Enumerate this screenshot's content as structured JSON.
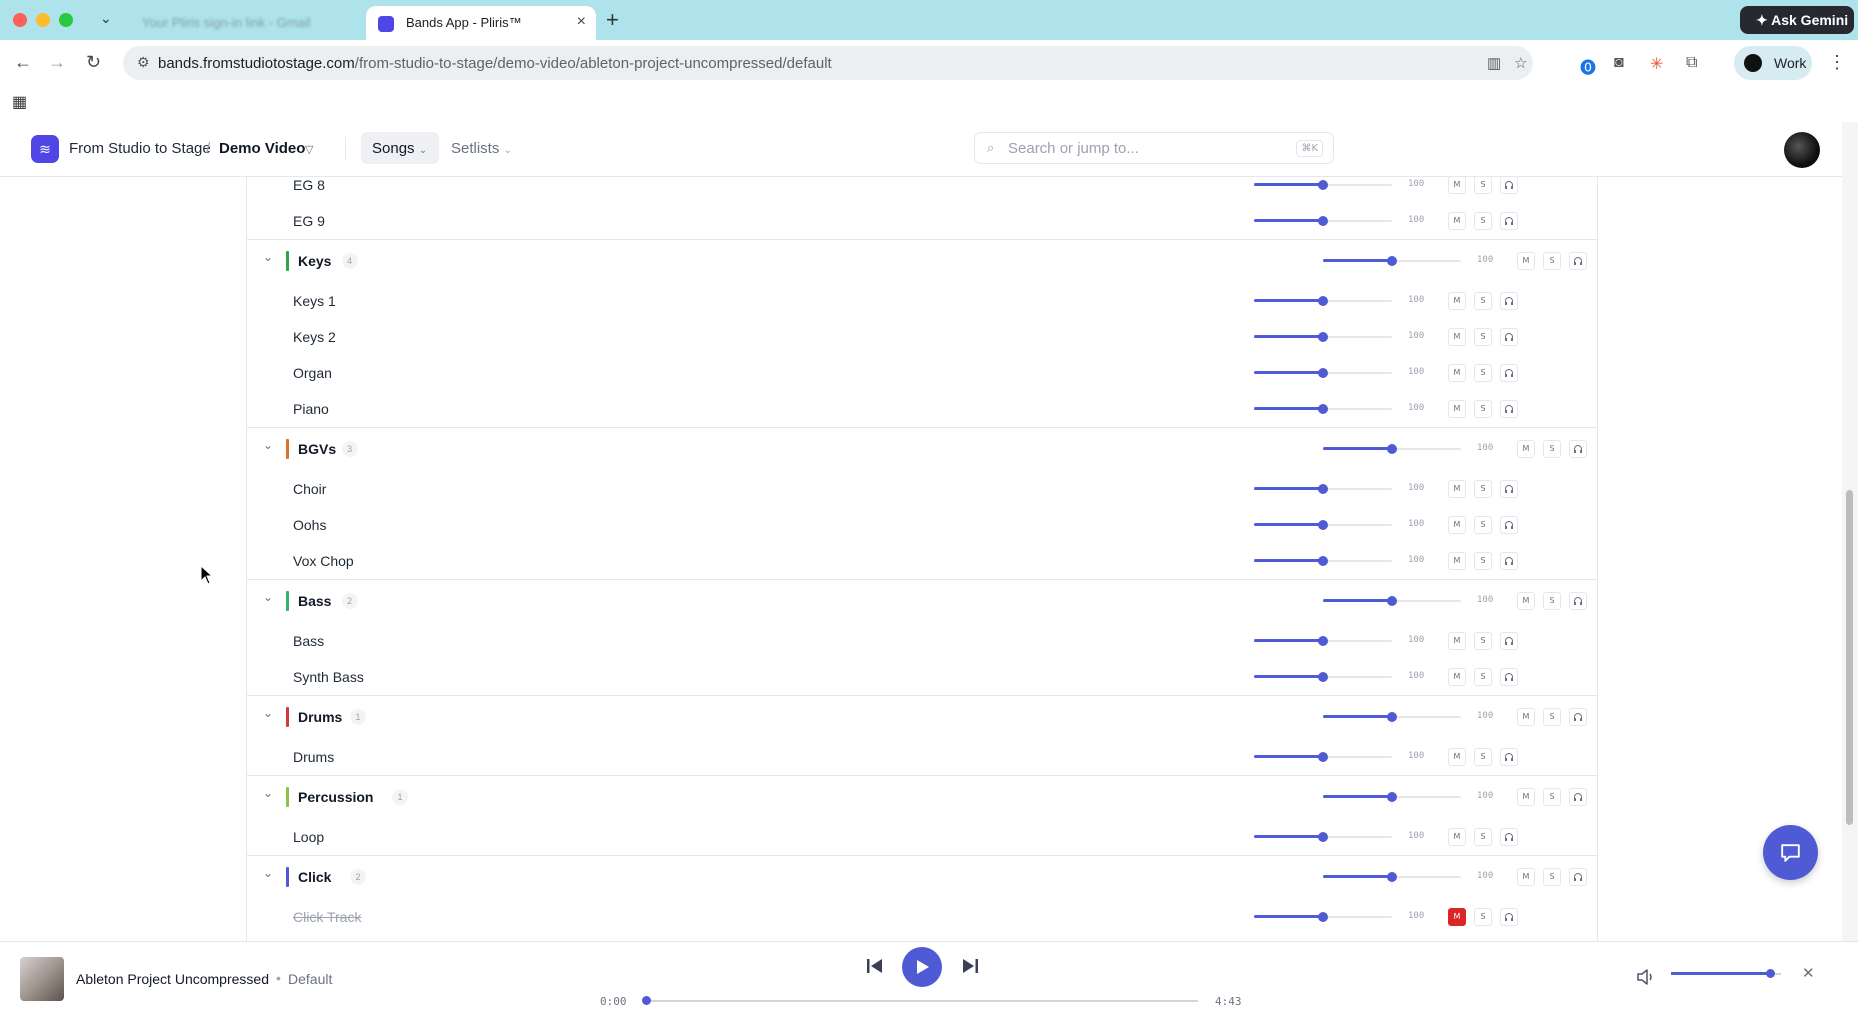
{
  "browser": {
    "inactive_tab_title": "Your Pliris sign-in link - Gmail",
    "active_tab_title": "Bands App - Pliris™",
    "url_host": "bands.fromstudiotostage.com",
    "url_path": "/from-studio-to-stage/demo-video/ableton-project-uncompressed/default",
    "gemini_label": "Ask Gemini",
    "profile_label": "Work"
  },
  "header": {
    "org": "From Studio to Stage",
    "separator": "/",
    "project": "Demo Video",
    "nav_songs": "Songs",
    "nav_setlists": "Setlists",
    "search_placeholder": "Search or jump to...",
    "search_shortcut": "⌘K"
  },
  "mixer": {
    "mute_label": "M",
    "solo_label": "S",
    "volume_default": "100",
    "rows": [
      {
        "type": "track",
        "name": "EG 8",
        "volume": 100,
        "muted": false
      },
      {
        "type": "track",
        "name": "EG 9",
        "volume": 100,
        "muted": false
      },
      {
        "type": "group",
        "name": "Keys",
        "count": "4",
        "color": "#2ea44f",
        "volume": 100
      },
      {
        "type": "track",
        "name": "Keys 1",
        "volume": 100,
        "muted": false
      },
      {
        "type": "track",
        "name": "Keys 2",
        "volume": 100,
        "muted": false
      },
      {
        "type": "track",
        "name": "Organ",
        "volume": 100,
        "muted": false
      },
      {
        "type": "track",
        "name": "Piano",
        "volume": 100,
        "muted": false
      },
      {
        "type": "group",
        "name": "BGVs",
        "count": "3",
        "color": "#d9762b",
        "volume": 100
      },
      {
        "type": "track",
        "name": "Choir",
        "volume": 100,
        "muted": false
      },
      {
        "type": "track",
        "name": "Oohs",
        "volume": 100,
        "muted": false
      },
      {
        "type": "track",
        "name": "Vox Chop",
        "volume": 100,
        "muted": false
      },
      {
        "type": "group",
        "name": "Bass",
        "count": "2",
        "color": "#34b36a",
        "volume": 100
      },
      {
        "type": "track",
        "name": "Bass",
        "volume": 100,
        "muted": false
      },
      {
        "type": "track",
        "name": "Synth Bass",
        "volume": 100,
        "muted": false
      },
      {
        "type": "group",
        "name": "Drums",
        "count": "1",
        "color": "#d13a3a",
        "volume": 100
      },
      {
        "type": "track",
        "name": "Drums",
        "volume": 100,
        "muted": false
      },
      {
        "type": "group",
        "name": "Percussion",
        "count": "1",
        "color": "#8bc34a",
        "volume": 100
      },
      {
        "type": "track",
        "name": "Loop",
        "volume": 100,
        "muted": false
      },
      {
        "type": "group",
        "name": "Click",
        "count": "2",
        "color": "#4f5bd5",
        "volume": 100
      },
      {
        "type": "track",
        "name": "Click Track",
        "volume": 100,
        "muted": true
      }
    ]
  },
  "player": {
    "song_title": "Ableton Project Uncompressed",
    "separator": "•",
    "version": "Default",
    "time_current": "0:00",
    "time_total": "4:43",
    "progress": 0,
    "master_volume": 0.9
  },
  "colors": {
    "accent": "#4f5bd5",
    "mute_active": "#dc2626"
  }
}
